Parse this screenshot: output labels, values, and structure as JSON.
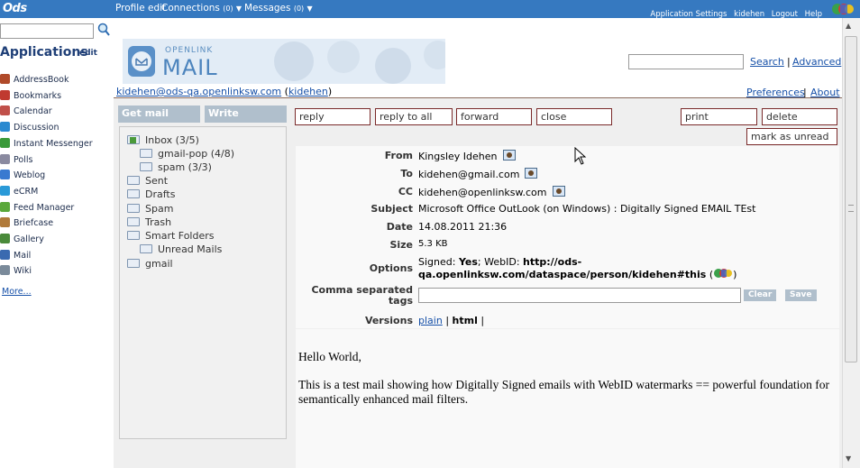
{
  "top": {
    "logo": "Ods",
    "profile": "Profile edit",
    "connections": "Connections",
    "connections_count": "(0)",
    "messages": "Messages",
    "messages_count": "(0)",
    "links": [
      "Application Settings",
      "kidehen",
      "Logout",
      "Help"
    ]
  },
  "sidebar": {
    "search_value": "",
    "title": "Applications",
    "edit": "edit",
    "items": [
      {
        "label": "AddressBook",
        "icon": "addressbook-icon",
        "color": "#b04a2a"
      },
      {
        "label": "Bookmarks",
        "icon": "bookmarks-icon",
        "color": "#c03a30"
      },
      {
        "label": "Calendar",
        "icon": "calendar-icon",
        "color": "#c0504a"
      },
      {
        "label": "Discussion",
        "icon": "discussion-icon",
        "color": "#2a8ad0"
      },
      {
        "label": "Instant Messenger",
        "icon": "messenger-icon",
        "color": "#3a9a3a"
      },
      {
        "label": "Polls",
        "icon": "polls-icon",
        "color": "#8a8aa0"
      },
      {
        "label": "Weblog",
        "icon": "weblog-icon",
        "color": "#3a7ad0"
      },
      {
        "label": "eCRM",
        "icon": "ecrm-icon",
        "color": "#2a9ad8"
      },
      {
        "label": "Feed Manager",
        "icon": "feed-icon",
        "color": "#5aa83a"
      },
      {
        "label": "Briefcase",
        "icon": "briefcase-icon",
        "color": "#b07a3a"
      },
      {
        "label": "Gallery",
        "icon": "gallery-icon",
        "color": "#4a8a3a"
      },
      {
        "label": "Mail",
        "icon": "mail-icon",
        "color": "#3a6ab0"
      },
      {
        "label": "Wiki",
        "icon": "wiki-icon",
        "color": "#7a8a9a"
      }
    ],
    "more": "More..."
  },
  "header": {
    "banner_small": "OPENLINK",
    "banner_big": "MAIL",
    "search_value": "",
    "search_link": "Search",
    "separator": "|",
    "advanced_link": "Advanced",
    "account_email": "kidehen@ods-qa.openlinksw.com",
    "account_user": "kidehen",
    "preferences": "Preferences",
    "about": "About"
  },
  "mail_buttons": {
    "get_mail": "Get mail",
    "write": "Write"
  },
  "actions": {
    "reply": "reply",
    "reply_all": "reply to all",
    "forward": "forward",
    "close": "close",
    "print": "print",
    "delete": "delete",
    "mark_unread": "mark as unread"
  },
  "folders": [
    {
      "label": "Inbox (3/5)",
      "level": 0
    },
    {
      "label": "gmail-pop (4/8)",
      "level": 1
    },
    {
      "label": "spam (3/3)",
      "level": 1
    },
    {
      "label": "Sent",
      "level": 0
    },
    {
      "label": "Drafts",
      "level": 0
    },
    {
      "label": "Spam",
      "level": 0
    },
    {
      "label": "Trash",
      "level": 0
    },
    {
      "label": "Smart Folders",
      "level": 0
    },
    {
      "label": "Unread Mails",
      "level": 1
    },
    {
      "label": "gmail",
      "level": 0
    }
  ],
  "message": {
    "from_label": "From",
    "from": "Kingsley Idehen",
    "to_label": "To",
    "to": "kidehen@gmail.com",
    "cc_label": "CC",
    "cc": "kidehen@openlinksw.com",
    "subject_label": "Subject",
    "subject": "Microsoft Office OutLook (on Windows) : Digitally Signed EMAIL TEst",
    "date_label": "Date",
    "date": "14.08.2011 21:36",
    "size_label": "Size",
    "size": "5.3 KB",
    "options_label": "Options",
    "options_signed": "Signed:",
    "options_yes": "Yes",
    "options_webid": "; WebID:",
    "options_url1": "http://ods-",
    "options_url2": "qa.openlinksw.com/dataspace/person/kidehen#this",
    "tags_label1": "Comma separated",
    "tags_label2": "tags",
    "tags_value": "",
    "clear": "Clear",
    "save": "Save",
    "versions_label": "Versions",
    "version_plain": "plain",
    "version_sep": "|",
    "version_html": "html",
    "version_sep2": "|",
    "body_line1": "Hello World,",
    "body_line2": "This is a test mail showing how Digitally Signed emails with WebID watermarks == powerful foundation for",
    "body_line3": "semantically enhanced mail filters."
  },
  "colors": {
    "topbar": "#3679c0",
    "button_bg": "#b0bfcc",
    "action_border": "#7a2a2a",
    "link": "#1650a8"
  }
}
